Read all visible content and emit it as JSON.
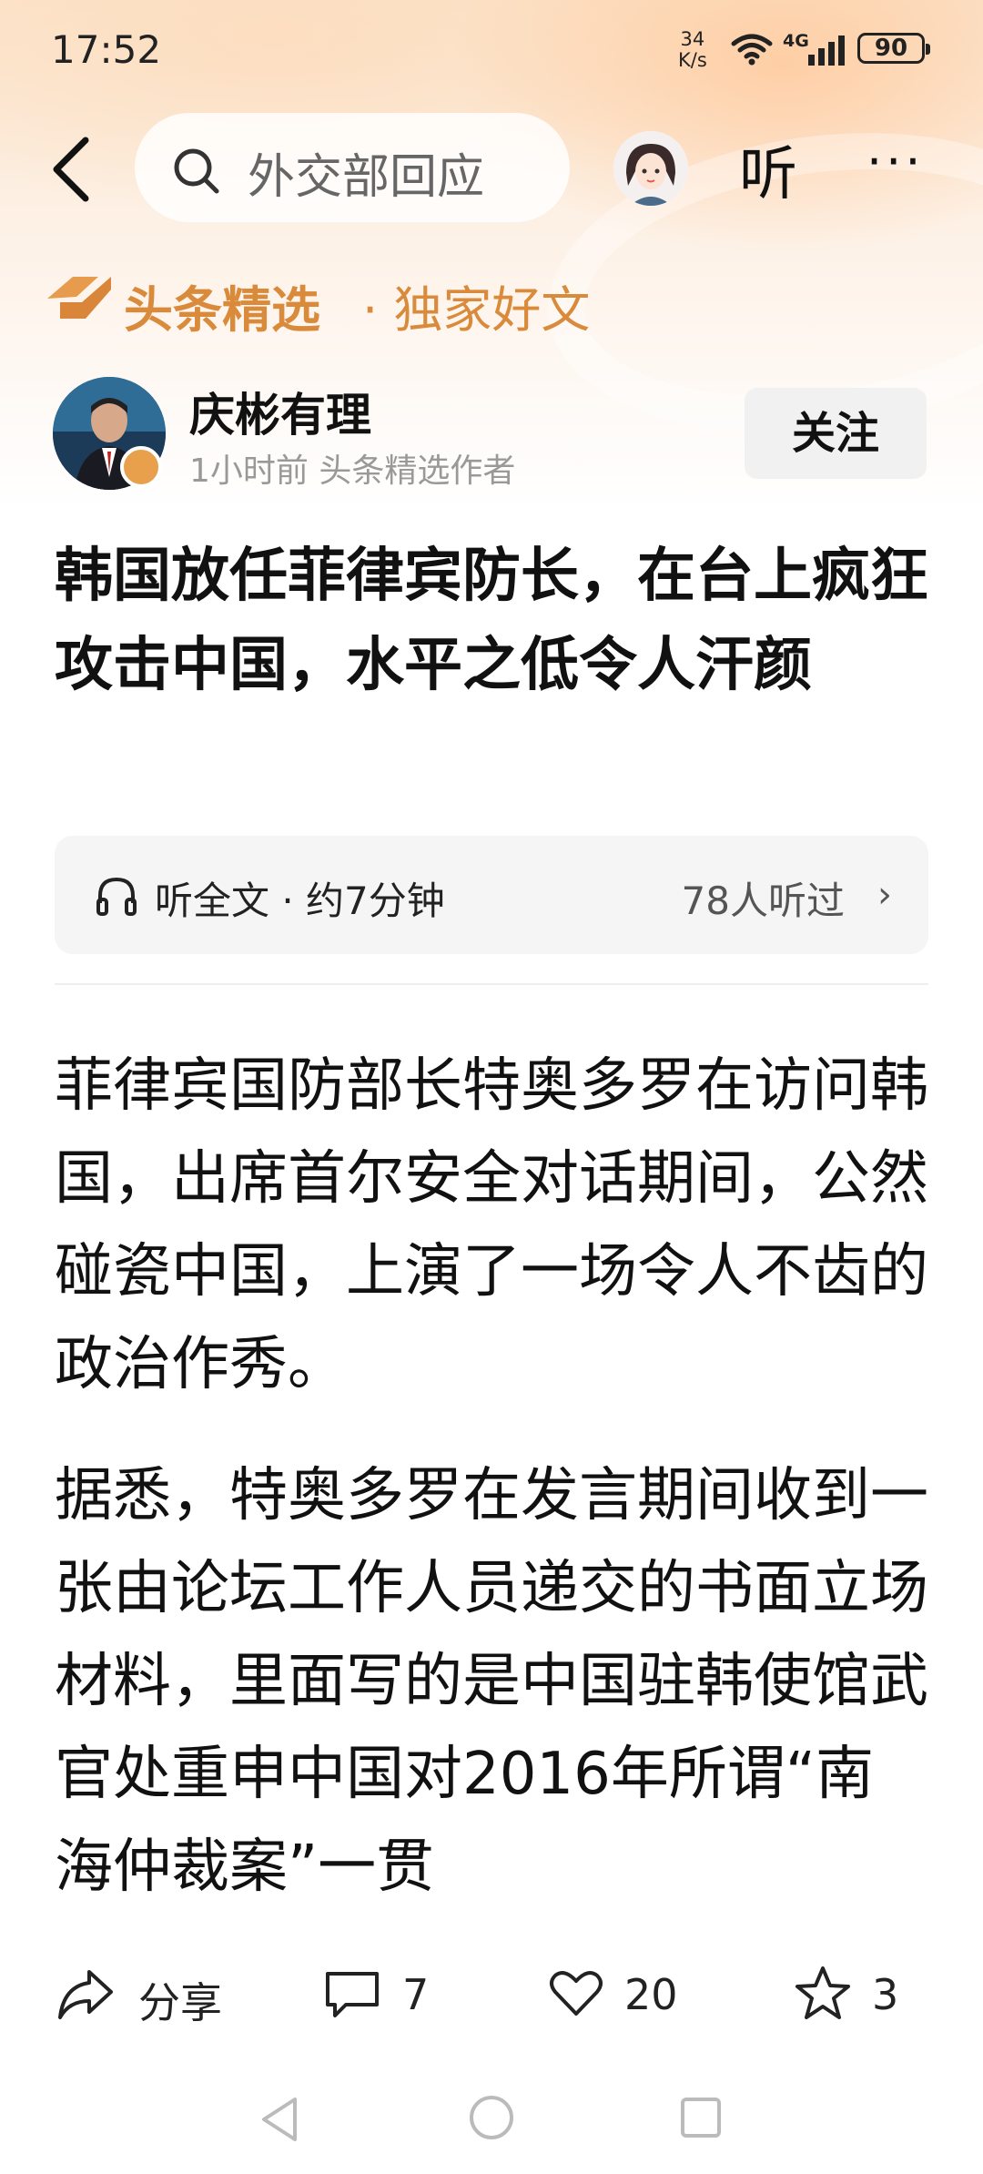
{
  "status": {
    "time": "17:52",
    "speed_value": "34",
    "speed_unit": "K/s",
    "network": "4G",
    "battery": "90"
  },
  "header": {
    "search_text": "外交部回应",
    "listen_label": "听",
    "more_label": "···"
  },
  "brand": {
    "name": "头条精选",
    "tagline": "· 独家好文"
  },
  "author": {
    "name": "庆彬有理",
    "meta": "1小时前  头条精选作者",
    "follow_label": "关注"
  },
  "article": {
    "title": "韩国放任菲律宾防长，在台上疯狂攻击中国，水平之低令人汗颜",
    "listen_text": "听全文 · 约7分钟",
    "listen_count": "78人听过",
    "paragraphs": [
      "菲律宾国防部长特奥多罗在访问韩国，出席首尔安全对话期间，公然碰瓷中国，上演了一场令人不齿的政治作秀。",
      "据悉，特奥多罗在发言期间收到一张由论坛工作人员递交的书面立场材料，里面写的是中国驻韩使馆武官处重申中国对2016年所谓“南海仲裁案”一贯"
    ]
  },
  "actions": {
    "share_label": "分享",
    "comment_count": "7",
    "like_count": "20",
    "favorite_count": "3"
  }
}
